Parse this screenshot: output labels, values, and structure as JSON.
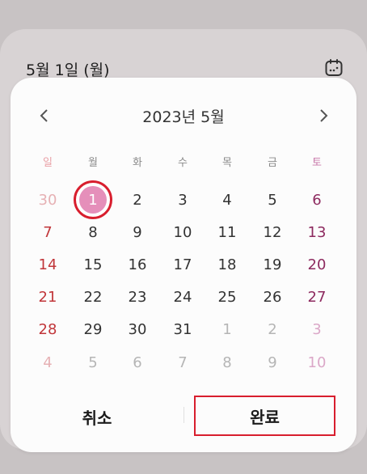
{
  "background_field": {
    "selected_date_text": "5월 1일 (월)",
    "icon": "calendar-icon"
  },
  "calendar": {
    "month_title": "2023년 5월",
    "prev_icon": "chevron-left-icon",
    "next_icon": "chevron-right-icon",
    "weekdays": [
      "일",
      "월",
      "화",
      "수",
      "목",
      "금",
      "토"
    ],
    "weeks": [
      [
        "30",
        "1",
        "2",
        "3",
        "4",
        "5",
        "6"
      ],
      [
        "7",
        "8",
        "9",
        "10",
        "11",
        "12",
        "13"
      ],
      [
        "14",
        "15",
        "16",
        "17",
        "18",
        "19",
        "20"
      ],
      [
        "21",
        "22",
        "23",
        "24",
        "25",
        "26",
        "27"
      ],
      [
        "28",
        "29",
        "30",
        "31",
        "1",
        "2",
        "3"
      ],
      [
        "4",
        "5",
        "6",
        "7",
        "8",
        "9",
        "10"
      ]
    ],
    "selected_day": "1"
  },
  "buttons": {
    "cancel_label": "취소",
    "done_label": "완료"
  },
  "colors": {
    "sunday": "#c1363a",
    "saturday": "#8d2a5f",
    "selected_fill": "#e58fba",
    "highlight_outline": "#d81e2e"
  }
}
